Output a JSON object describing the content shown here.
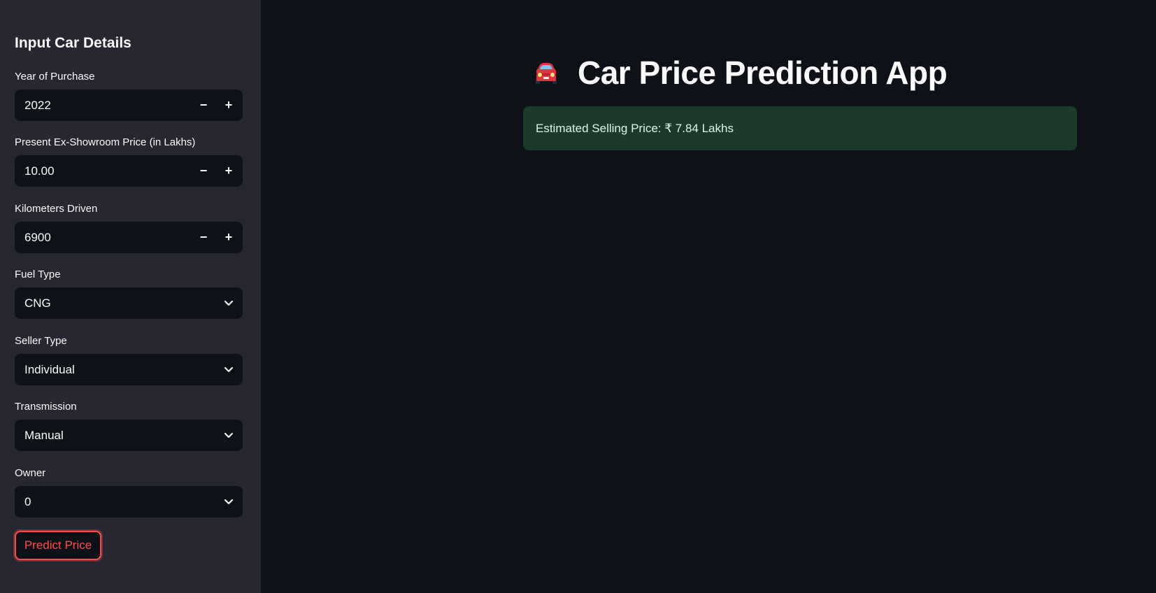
{
  "sidebar": {
    "title": "Input Car Details",
    "fields": {
      "year": {
        "label": "Year of Purchase",
        "value": "2022"
      },
      "price": {
        "label": "Present Ex-Showroom Price (in Lakhs)",
        "value": "10.00"
      },
      "km": {
        "label": "Kilometers Driven",
        "value": "6900"
      },
      "fuel": {
        "label": "Fuel Type",
        "value": "CNG"
      },
      "seller": {
        "label": "Seller Type",
        "value": "Individual"
      },
      "transmission": {
        "label": "Transmission",
        "value": "Manual"
      },
      "owner": {
        "label": "Owner",
        "value": "0"
      }
    },
    "stepper": {
      "minus": "−",
      "plus": "+"
    },
    "predict_button": "Predict Price"
  },
  "main": {
    "icon": "car-icon",
    "title": "Car Price Prediction App",
    "result": "Estimated Selling Price: ₹ 7.84 Lakhs"
  },
  "colors": {
    "background": "#0e1117",
    "sidebar": "#262730",
    "accent": "#ff4b4b",
    "success_bg": "#1b3a2a"
  }
}
